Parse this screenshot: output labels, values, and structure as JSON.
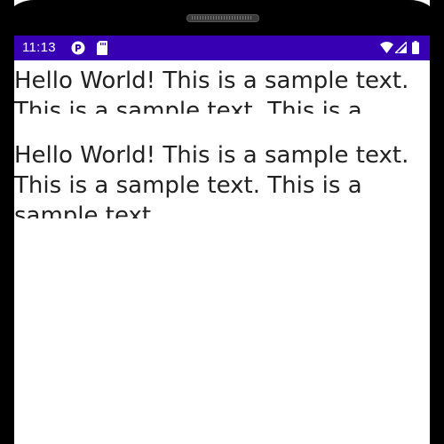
{
  "status_bar": {
    "time": "11:13",
    "background_color": "#3700b3",
    "notification_icons": [
      "app-notification-icon",
      "sd-card-icon"
    ],
    "system_icons": [
      "wifi-icon",
      "cell-signal-icon",
      "battery-icon"
    ]
  },
  "content": {
    "text_views": [
      {
        "text": "Hello World! This is a sample text. This is a sample text. This is a sample text."
      },
      {
        "text": "Hello World! This is a sample text. This is a sample text. This is a sample text."
      }
    ]
  }
}
